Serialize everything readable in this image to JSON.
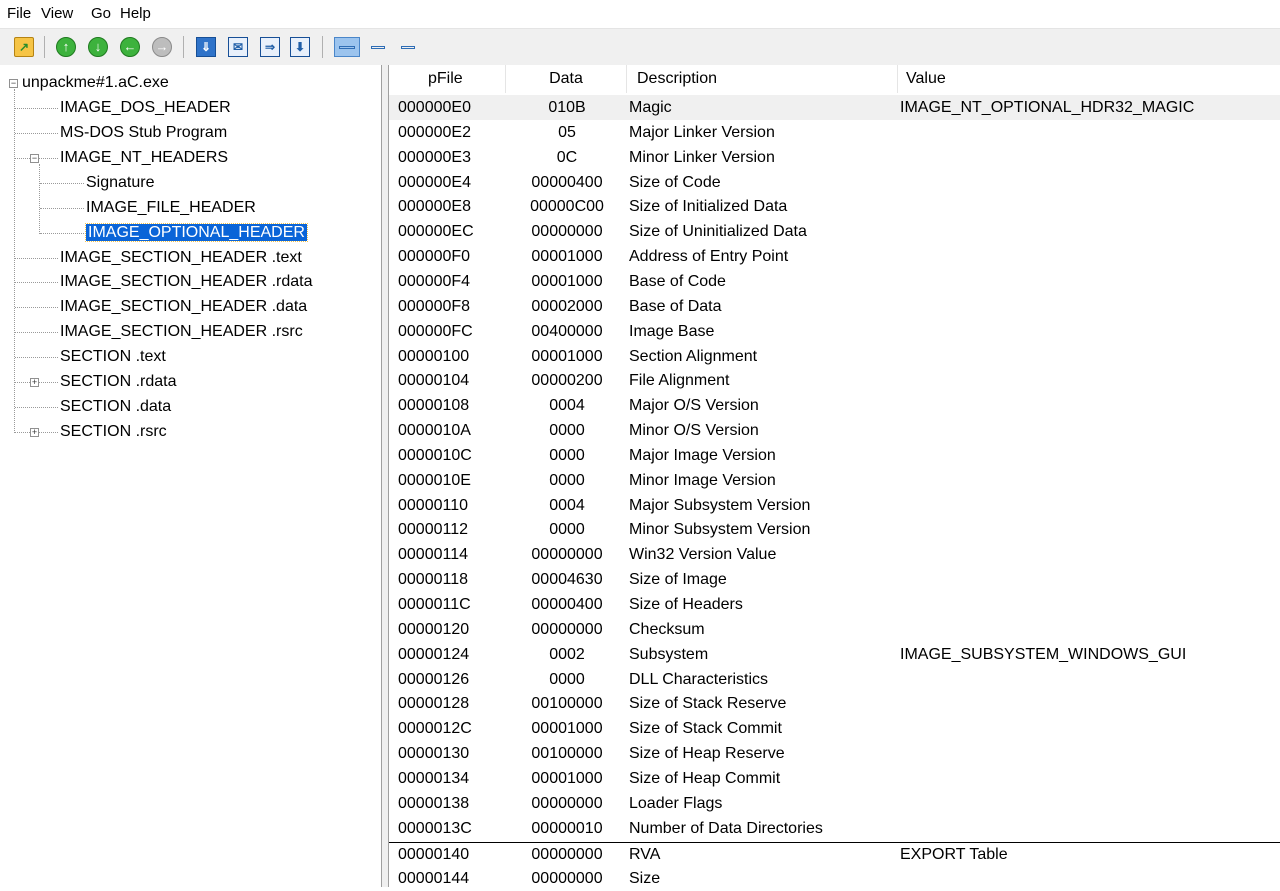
{
  "menu": [
    "File",
    "View",
    "Go",
    "Help"
  ],
  "toolbar": {
    "buttons": [
      {
        "name": "open-file-icon"
      },
      {
        "name": "go-up-icon"
      },
      {
        "name": "go-down-icon"
      },
      {
        "name": "go-back-icon"
      },
      {
        "name": "go-forward-icon"
      },
      {
        "name": "save-as-icon"
      },
      {
        "name": "mail-icon"
      },
      {
        "name": "export-icon"
      },
      {
        "name": "download-icon"
      },
      {
        "name": "view-hex-icon"
      },
      {
        "name": "view-list-icon"
      },
      {
        "name": "view-detail-icon"
      }
    ]
  },
  "tree": {
    "root": "unpackme#1.aC.exe",
    "nodes": [
      {
        "label": "IMAGE_DOS_HEADER",
        "level": 1
      },
      {
        "label": "MS-DOS Stub Program",
        "level": 1
      },
      {
        "label": "IMAGE_NT_HEADERS",
        "level": 1,
        "expander": "-"
      },
      {
        "label": "Signature",
        "level": 2
      },
      {
        "label": "IMAGE_FILE_HEADER",
        "level": 2
      },
      {
        "label": "IMAGE_OPTIONAL_HEADER",
        "level": 2,
        "selected": true
      },
      {
        "label": "IMAGE_SECTION_HEADER .text",
        "level": 1
      },
      {
        "label": "IMAGE_SECTION_HEADER .rdata",
        "level": 1
      },
      {
        "label": "IMAGE_SECTION_HEADER .data",
        "level": 1
      },
      {
        "label": "IMAGE_SECTION_HEADER .rsrc",
        "level": 1
      },
      {
        "label": "SECTION .text",
        "level": 1
      },
      {
        "label": "SECTION .rdata",
        "level": 1,
        "expander": "+"
      },
      {
        "label": "SECTION .data",
        "level": 1
      },
      {
        "label": "SECTION .rsrc",
        "level": 1,
        "expander": "+"
      }
    ]
  },
  "columns": [
    "pFile",
    "Data",
    "Description",
    "Value"
  ],
  "rows": [
    [
      "000000E0",
      "010B",
      "Magic",
      "IMAGE_NT_OPTIONAL_HDR32_MAGIC"
    ],
    [
      "000000E2",
      "05",
      "Major Linker Version",
      ""
    ],
    [
      "000000E3",
      "0C",
      "Minor Linker Version",
      ""
    ],
    [
      "000000E4",
      "00000400",
      "Size of Code",
      ""
    ],
    [
      "000000E8",
      "00000C00",
      "Size of Initialized Data",
      ""
    ],
    [
      "000000EC",
      "00000000",
      "Size of Uninitialized Data",
      ""
    ],
    [
      "000000F0",
      "00001000",
      "Address of Entry Point",
      ""
    ],
    [
      "000000F4",
      "00001000",
      "Base of Code",
      ""
    ],
    [
      "000000F8",
      "00002000",
      "Base of Data",
      ""
    ],
    [
      "000000FC",
      "00400000",
      "Image Base",
      ""
    ],
    [
      "00000100",
      "00001000",
      "Section Alignment",
      ""
    ],
    [
      "00000104",
      "00000200",
      "File Alignment",
      ""
    ],
    [
      "00000108",
      "0004",
      "Major O/S Version",
      ""
    ],
    [
      "0000010A",
      "0000",
      "Minor O/S Version",
      ""
    ],
    [
      "0000010C",
      "0000",
      "Major Image Version",
      ""
    ],
    [
      "0000010E",
      "0000",
      "Minor Image Version",
      ""
    ],
    [
      "00000110",
      "0004",
      "Major Subsystem Version",
      ""
    ],
    [
      "00000112",
      "0000",
      "Minor Subsystem Version",
      ""
    ],
    [
      "00000114",
      "00000000",
      "Win32 Version Value",
      ""
    ],
    [
      "00000118",
      "00004630",
      "Size of Image",
      ""
    ],
    [
      "0000011C",
      "00000400",
      "Size of Headers",
      ""
    ],
    [
      "00000120",
      "00000000",
      "Checksum",
      ""
    ],
    [
      "00000124",
      "0002",
      "Subsystem",
      "IMAGE_SUBSYSTEM_WINDOWS_GUI"
    ],
    [
      "00000126",
      "0000",
      "DLL Characteristics",
      ""
    ],
    [
      "00000128",
      "00100000",
      "Size of Stack Reserve",
      ""
    ],
    [
      "0000012C",
      "00001000",
      "Size of Stack Commit",
      ""
    ],
    [
      "00000130",
      "00100000",
      "Size of Heap Reserve",
      ""
    ],
    [
      "00000134",
      "00001000",
      "Size of Heap Commit",
      ""
    ],
    [
      "00000138",
      "00000000",
      "Loader Flags",
      ""
    ],
    [
      "0000013C",
      "00000010",
      "Number of Data Directories",
      ""
    ],
    [
      "00000140",
      "00000000",
      "RVA",
      "EXPORT Table"
    ],
    [
      "00000144",
      "00000000",
      "Size",
      ""
    ]
  ],
  "colors": {
    "selection": "#0a64d8",
    "toolbar_bg": "#f0f0f0"
  }
}
